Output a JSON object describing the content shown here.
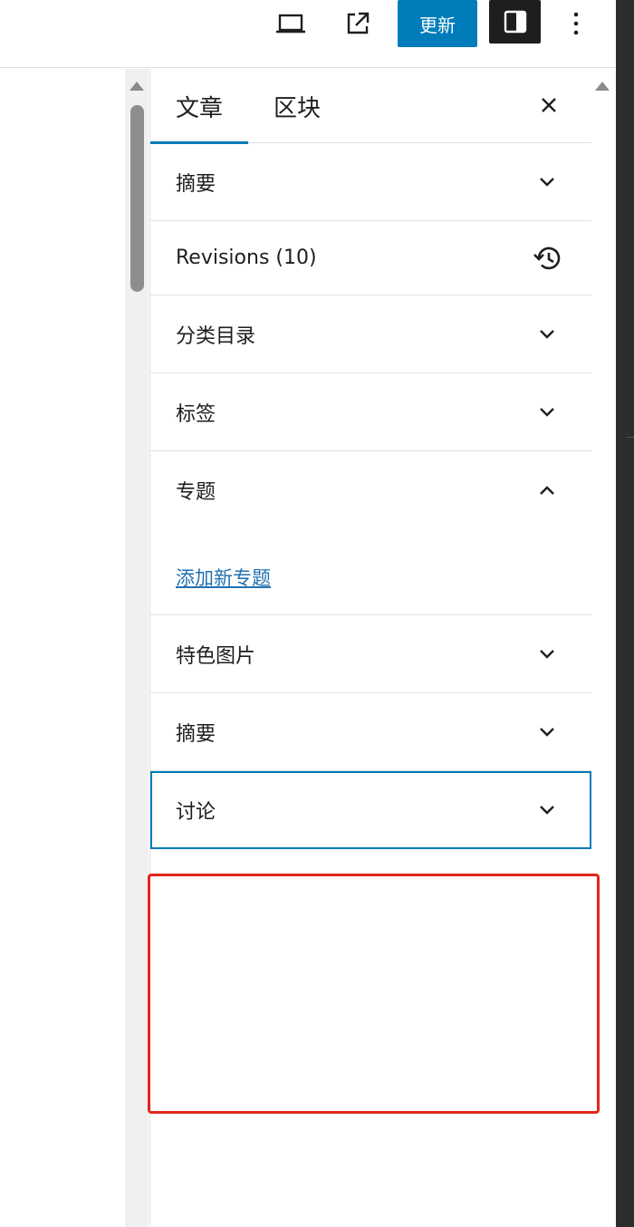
{
  "toolbar": {
    "preview_icon": "laptop-icon",
    "view_icon": "external-link-icon",
    "update_label": "更新",
    "settings_icon": "sidebar-panel-icon",
    "options_icon": "vertical-dots-icon",
    "accent_color": "#007cba"
  },
  "sidebar": {
    "tabs": [
      {
        "label": "文章",
        "active": true
      },
      {
        "label": "区块",
        "active": false
      }
    ],
    "close_icon": "close-icon",
    "panels": [
      {
        "label": "摘要",
        "icon": "chevron-down-icon"
      },
      {
        "label": "Revisions (10)",
        "icon": "history-icon"
      },
      {
        "label": "分类目录",
        "icon": "chevron-down-icon"
      },
      {
        "label": "标签",
        "icon": "chevron-down-icon"
      },
      {
        "label": "专题",
        "icon": "chevron-up-icon",
        "link": "添加新专题"
      },
      {
        "label": "特色图片",
        "icon": "chevron-down-icon"
      },
      {
        "label": "摘要",
        "icon": "chevron-down-icon"
      },
      {
        "label": "讨论",
        "icon": "chevron-down-icon"
      }
    ]
  },
  "highlight_color": "#e3261d"
}
